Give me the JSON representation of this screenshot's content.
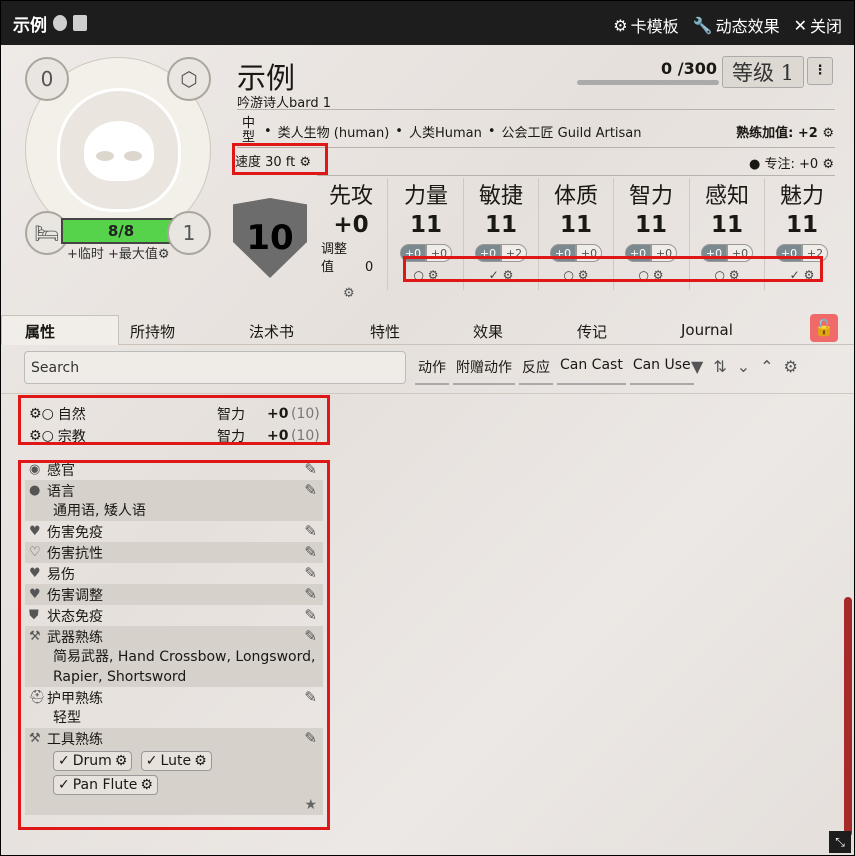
{
  "window": {
    "title": "示例",
    "tb_buttons": [
      "卡模板",
      "动态效果",
      "关闭"
    ]
  },
  "header": {
    "name": "示例",
    "class_line": "吟游诗人bard 1",
    "xp": "0 /300",
    "level": "等级 1",
    "kebab": "⋮",
    "size": "中型",
    "traits": [
      "类人生物 (human)",
      "人类Human",
      "公会工匠 Guild Artisan"
    ],
    "proficiency": "熟练加值: +2",
    "speed": "速度 30 ft",
    "concentration": "专注: +0"
  },
  "portrait": {
    "top_left_badge": "0",
    "rest_badge": "1",
    "hp": "8/8",
    "hp_extra": "+临时 +最大值"
  },
  "combat": {
    "ac": "10",
    "initiative_label": "先攻",
    "initiative_value": "+0",
    "init_adjust_label": "调整值",
    "init_adjust_value": "0"
  },
  "abilities": [
    {
      "label": "力量",
      "value": "11",
      "mod": "+0",
      "save": "+0",
      "prof": "○"
    },
    {
      "label": "敏捷",
      "value": "11",
      "mod": "+0",
      "save": "+2",
      "prof": "✓"
    },
    {
      "label": "体质",
      "value": "11",
      "mod": "+0",
      "save": "+0",
      "prof": "○"
    },
    {
      "label": "智力",
      "value": "11",
      "mod": "+0",
      "save": "+0",
      "prof": "○"
    },
    {
      "label": "感知",
      "value": "11",
      "mod": "+0",
      "save": "+0",
      "prof": "○"
    },
    {
      "label": "魅力",
      "value": "11",
      "mod": "+0",
      "save": "+2",
      "prof": "✓"
    }
  ],
  "tabs": [
    "属性",
    "所持物",
    "法术书",
    "特性",
    "效果",
    "传记",
    "Journal"
  ],
  "search": {
    "placeholder": "Search"
  },
  "filters": [
    "动作",
    "附赠动作",
    "反应",
    "Can Cast",
    "Can Use"
  ],
  "skills": [
    {
      "name": "自然",
      "ability": "智力",
      "mod": "+0",
      "passive": "(10)"
    },
    {
      "name": "宗教",
      "ability": "智力",
      "mod": "+0",
      "passive": "(10)"
    }
  ],
  "traits": [
    {
      "label": "感官",
      "body": ""
    },
    {
      "label": "语言",
      "body": "通用语, 矮人语"
    },
    {
      "label": "伤害免疫",
      "body": ""
    },
    {
      "label": "伤害抗性",
      "body": ""
    },
    {
      "label": "易伤",
      "body": ""
    },
    {
      "label": "伤害调整",
      "body": ""
    },
    {
      "label": "状态免疫",
      "body": ""
    },
    {
      "label": "武器熟练",
      "body": "简易武器, Hand Crossbow, Longsword, Rapier, Shortsword"
    },
    {
      "label": "护甲熟练",
      "body": "轻型"
    },
    {
      "label": "工具熟练",
      "body": ""
    }
  ],
  "tools": [
    "Drum",
    "Lute",
    "Pan Flute"
  ],
  "colors": {
    "accent_red": "#e01717",
    "hp_green": "#56d34b",
    "titlebar": "#1d1d1d"
  }
}
